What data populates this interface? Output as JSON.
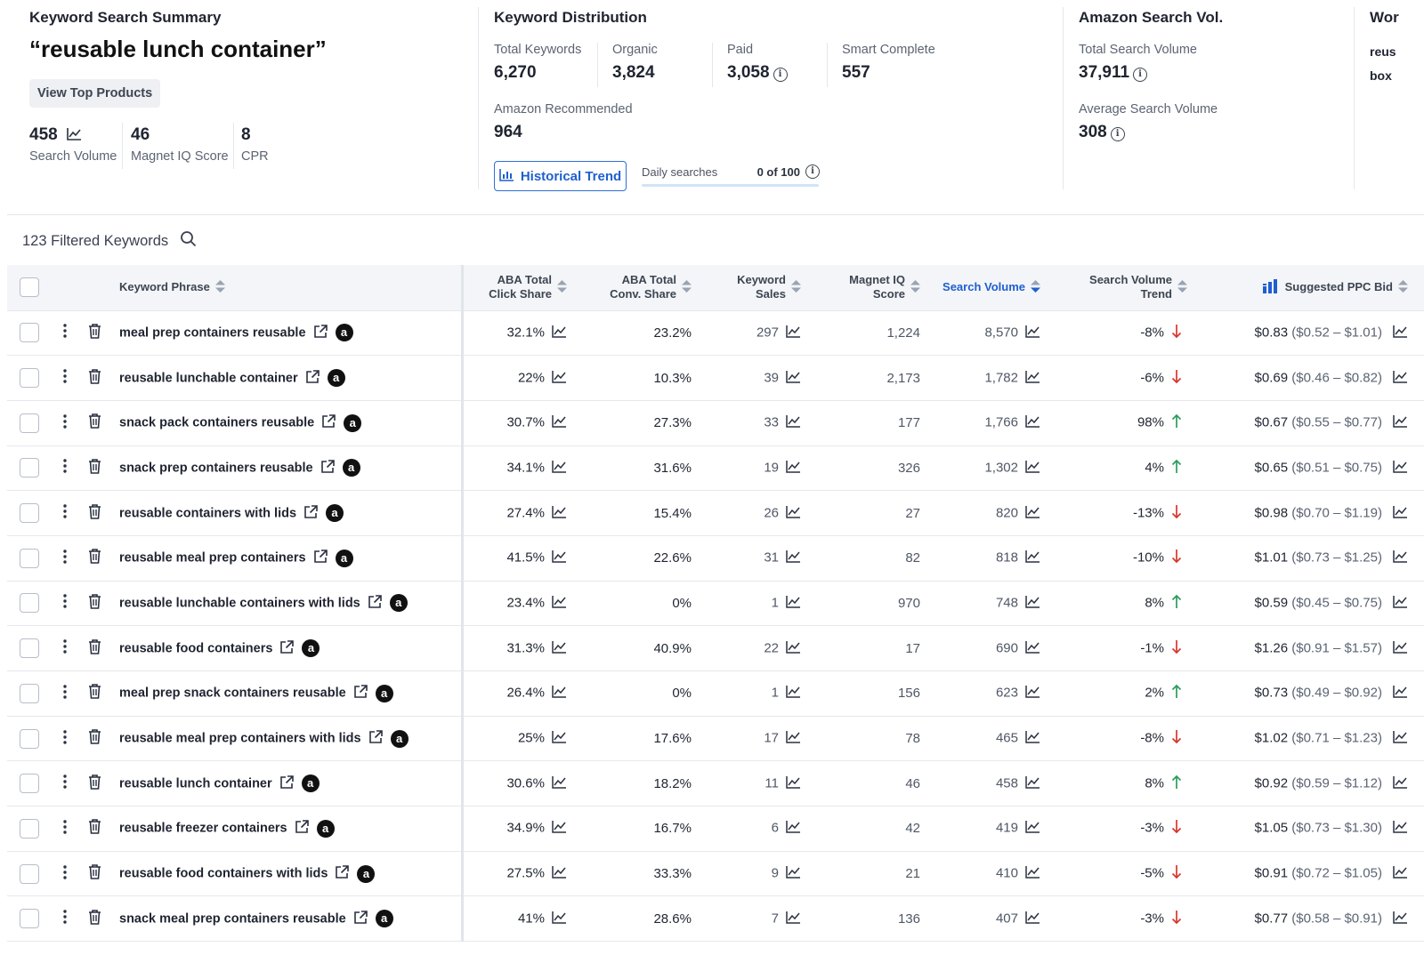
{
  "summary": {
    "title": "Keyword Search Summary",
    "query": "“reusable lunch container”",
    "view_top_label": "View Top Products",
    "stats": [
      {
        "value": "458",
        "label": "Search Volume"
      },
      {
        "value": "46",
        "label": "Magnet IQ Score"
      },
      {
        "value": "8",
        "label": "CPR"
      }
    ]
  },
  "distribution": {
    "title": "Keyword Distribution",
    "total_label": "Total Keywords",
    "total": "6,270",
    "organic_label": "Organic",
    "organic": "3,824",
    "paid_label": "Paid",
    "paid": "3,058",
    "smart_label": "Smart Complete",
    "smart": "557",
    "amazon_rec_label": "Amazon Recommended",
    "amazon_rec": "964",
    "trend_button": "Historical Trend",
    "daily_label": "Daily searches",
    "daily_value": "0 of 100",
    "daily_used_fraction": 0
  },
  "amazon_vol": {
    "title": "Amazon Search Vol.",
    "total_label": "Total Search Volume",
    "total": "37,911",
    "avg_label": "Average Search Volume",
    "avg": "308"
  },
  "word_card": {
    "title": "Wor",
    "line1": "reus",
    "line2": "box"
  },
  "filter": {
    "label": "123 Filtered Keywords"
  },
  "columns": {
    "phrase": "Keyword Phrase",
    "click_share": [
      "ABA Total",
      "Click Share"
    ],
    "conv_share": [
      "ABA Total",
      "Conv. Share"
    ],
    "sales": [
      "Keyword",
      "Sales"
    ],
    "miq": [
      "Magnet IQ",
      "Score"
    ],
    "volume": "Search Volume",
    "trend": [
      "Search Volume",
      "Trend"
    ],
    "ppc": "Suggested PPC Bid"
  },
  "colors": {
    "accent": "#1f5fcf",
    "up": "#2a9d5a",
    "down": "#d6372c"
  },
  "rows": [
    {
      "phrase": "meal prep containers reusable",
      "click": "32.1%",
      "conv": "23.2%",
      "sales": "297",
      "miq": "1,224",
      "vol": "8,570",
      "trend": "-8%",
      "dir": "down",
      "bid": "$0.83",
      "range": "($0.52 – $1.01)"
    },
    {
      "phrase": "reusable lunchable container",
      "click": "22%",
      "conv": "10.3%",
      "sales": "39",
      "miq": "2,173",
      "vol": "1,782",
      "trend": "-6%",
      "dir": "down",
      "bid": "$0.69",
      "range": "($0.46 – $0.82)"
    },
    {
      "phrase": "snack pack containers reusable",
      "click": "30.7%",
      "conv": "27.3%",
      "sales": "33",
      "miq": "177",
      "vol": "1,766",
      "trend": "98%",
      "dir": "up",
      "bid": "$0.67",
      "range": "($0.55 – $0.77)"
    },
    {
      "phrase": "snack prep containers reusable",
      "click": "34.1%",
      "conv": "31.6%",
      "sales": "19",
      "miq": "326",
      "vol": "1,302",
      "trend": "4%",
      "dir": "up",
      "bid": "$0.65",
      "range": "($0.51 – $0.75)"
    },
    {
      "phrase": "reusable containers with lids",
      "click": "27.4%",
      "conv": "15.4%",
      "sales": "26",
      "miq": "27",
      "vol": "820",
      "trend": "-13%",
      "dir": "down",
      "bid": "$0.98",
      "range": "($0.70 – $1.19)"
    },
    {
      "phrase": "reusable meal prep containers",
      "click": "41.5%",
      "conv": "22.6%",
      "sales": "31",
      "miq": "82",
      "vol": "818",
      "trend": "-10%",
      "dir": "down",
      "bid": "$1.01",
      "range": "($0.73 – $1.25)"
    },
    {
      "phrase": "reusable lunchable containers with lids",
      "click": "23.4%",
      "conv": "0%",
      "sales": "1",
      "miq": "970",
      "vol": "748",
      "trend": "8%",
      "dir": "up",
      "bid": "$0.59",
      "range": "($0.45 – $0.75)"
    },
    {
      "phrase": "reusable food containers",
      "click": "31.3%",
      "conv": "40.9%",
      "sales": "22",
      "miq": "17",
      "vol": "690",
      "trend": "-1%",
      "dir": "down",
      "bid": "$1.26",
      "range": "($0.91 – $1.57)"
    },
    {
      "phrase": "meal prep snack containers reusable",
      "click": "26.4%",
      "conv": "0%",
      "sales": "1",
      "miq": "156",
      "vol": "623",
      "trend": "2%",
      "dir": "up",
      "bid": "$0.73",
      "range": "($0.49 – $0.92)"
    },
    {
      "phrase": "reusable meal prep containers with lids",
      "click": "25%",
      "conv": "17.6%",
      "sales": "17",
      "miq": "78",
      "vol": "465",
      "trend": "-8%",
      "dir": "down",
      "bid": "$1.02",
      "range": "($0.71 – $1.23)"
    },
    {
      "phrase": "reusable lunch container",
      "click": "30.6%",
      "conv": "18.2%",
      "sales": "11",
      "miq": "46",
      "vol": "458",
      "trend": "8%",
      "dir": "up",
      "bid": "$0.92",
      "range": "($0.59 – $1.12)"
    },
    {
      "phrase": "reusable freezer containers",
      "click": "34.9%",
      "conv": "16.7%",
      "sales": "6",
      "miq": "42",
      "vol": "419",
      "trend": "-3%",
      "dir": "down",
      "bid": "$1.05",
      "range": "($0.73 – $1.30)"
    },
    {
      "phrase": "reusable food containers with lids",
      "click": "27.5%",
      "conv": "33.3%",
      "sales": "9",
      "miq": "21",
      "vol": "410",
      "trend": "-5%",
      "dir": "down",
      "bid": "$0.91",
      "range": "($0.72 – $1.05)"
    },
    {
      "phrase": "snack meal prep containers reusable",
      "click": "41%",
      "conv": "28.6%",
      "sales": "7",
      "miq": "136",
      "vol": "407",
      "trend": "-3%",
      "dir": "down",
      "bid": "$0.77",
      "range": "($0.58 – $0.91)"
    }
  ]
}
